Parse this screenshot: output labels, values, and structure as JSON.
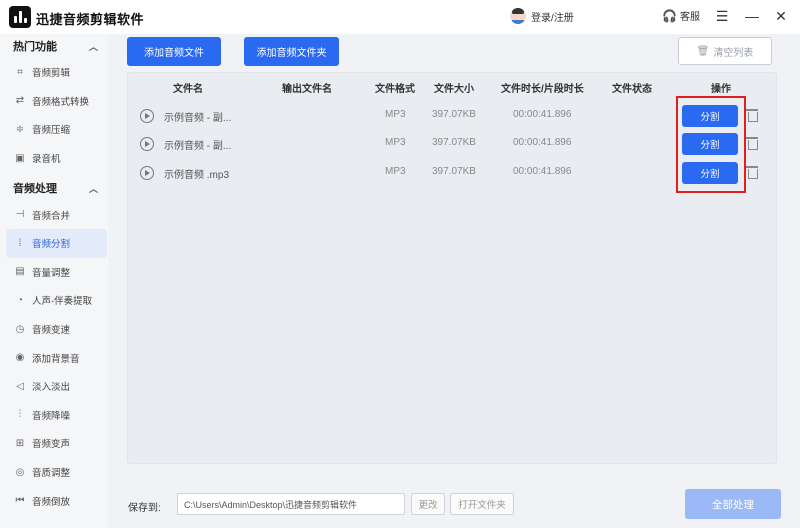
{
  "app": {
    "title": "迅捷音频剪辑软件",
    "login_label": "登录/注册",
    "service_label": "客服"
  },
  "window": {
    "menu_glyph": "☰",
    "minimize_glyph": "—",
    "close_glyph": "✕"
  },
  "sidebar": {
    "sections": [
      {
        "title": "热门功能",
        "items": [
          {
            "label": "音频剪辑",
            "icon": "scissors-icon"
          },
          {
            "label": "音频格式转换",
            "icon": "convert-icon"
          },
          {
            "label": "音频压缩",
            "icon": "compress-icon"
          },
          {
            "label": "录音机",
            "icon": "recorder-icon"
          }
        ]
      },
      {
        "title": "音频处理",
        "items": [
          {
            "label": "音频合并",
            "icon": "merge-icon"
          },
          {
            "label": "音频分割",
            "icon": "split-icon",
            "active": true
          },
          {
            "label": "音量调整",
            "icon": "volume-icon"
          },
          {
            "label": "人声-伴奏提取",
            "icon": "vocal-icon"
          },
          {
            "label": "音频变速",
            "icon": "speed-icon"
          },
          {
            "label": "添加背景音",
            "icon": "background-music-icon"
          },
          {
            "label": "淡入淡出",
            "icon": "fade-icon"
          },
          {
            "label": "音频降噪",
            "icon": "denoise-icon"
          },
          {
            "label": "音频变声",
            "icon": "voice-change-icon"
          },
          {
            "label": "音质调整",
            "icon": "quality-icon"
          },
          {
            "label": "音频倒放",
            "icon": "reverse-icon"
          }
        ]
      }
    ]
  },
  "toolbar": {
    "add_file": "添加音频文件",
    "add_folder": "添加音频文件夹",
    "clear_list": "清空列表"
  },
  "table": {
    "headers": [
      "文件名",
      "输出文件名",
      "文件格式",
      "文件大小",
      "文件时长/片段时长",
      "文件状态",
      "操作"
    ],
    "rows": [
      {
        "name": "示例音频 - 副...",
        "format": "MP3",
        "size": "397.07KB",
        "duration": "00:00:41.896",
        "action": "分割"
      },
      {
        "name": "示例音频 - 副...",
        "format": "MP3",
        "size": "397.07KB",
        "duration": "00:00:41.896",
        "action": "分割"
      },
      {
        "name": "示例音频 .mp3",
        "format": "MP3",
        "size": "397.07KB",
        "duration": "00:00:41.896",
        "action": "分割"
      }
    ]
  },
  "footer": {
    "save_label": "保存到:",
    "path": "C:\\Users\\Admin\\Desktop\\迅捷音频剪辑软件",
    "change": "更改",
    "open_folder": "打开文件夹",
    "process_all": "全部处理"
  },
  "colors": {
    "accent": "#2a6af0",
    "highlight": "#e01f1f",
    "process_disabled": "#9bb9f7"
  }
}
